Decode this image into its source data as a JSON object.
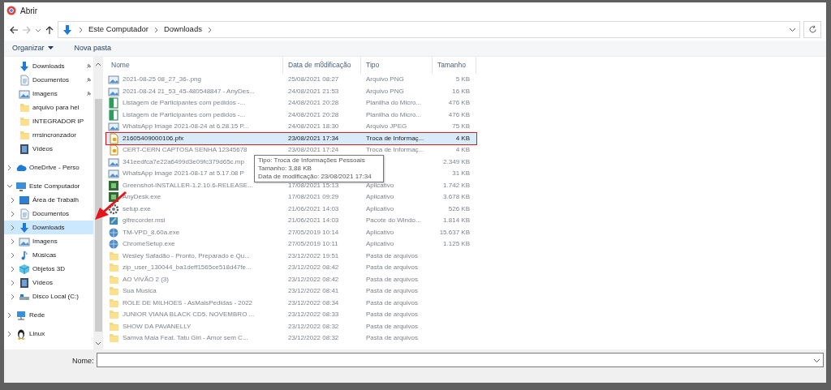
{
  "window": {
    "title": "Abrir"
  },
  "address": {
    "crumbs": [
      "Este Computador",
      "Downloads"
    ]
  },
  "toolbar": {
    "organize": "Organizar",
    "new_folder": "Nova pasta"
  },
  "sidebar": {
    "quick_access": [
      {
        "label": "Downloads",
        "kind": "download",
        "pinned": true
      },
      {
        "label": "Documentos",
        "kind": "document",
        "pinned": true
      },
      {
        "label": "Imagens",
        "kind": "image",
        "pinned": true
      },
      {
        "label": "arquivo para hel",
        "kind": "folder",
        "pinned": false
      },
      {
        "label": "INTEGRADOR IP",
        "kind": "folder",
        "pinned": false
      },
      {
        "label": "rrrsincronzador",
        "kind": "folder",
        "pinned": false
      },
      {
        "label": "Vídeos",
        "kind": "video",
        "pinned": false
      }
    ],
    "tree": [
      {
        "label": "OneDrive - Perso",
        "kind": "cloud",
        "expanded": false,
        "selected": false
      },
      {
        "label": "Este Computador",
        "kind": "computer",
        "expanded": true,
        "selected": false,
        "children": [
          {
            "label": "Área de Trabalh",
            "kind": "desktop",
            "expanded": false,
            "selected": false
          },
          {
            "label": "Documentos",
            "kind": "document",
            "expanded": false,
            "selected": false
          },
          {
            "label": "Downloads",
            "kind": "download",
            "expanded": false,
            "selected": true
          },
          {
            "label": "Imagens",
            "kind": "image",
            "expanded": false,
            "selected": false
          },
          {
            "label": "Músicas",
            "kind": "music",
            "expanded": false,
            "selected": false
          },
          {
            "label": "Objetos 3D",
            "kind": "cube",
            "expanded": false,
            "selected": false
          },
          {
            "label": "Vídeos",
            "kind": "video",
            "expanded": false,
            "selected": false
          },
          {
            "label": "Disco Local (C:)",
            "kind": "disk",
            "expanded": false,
            "selected": false
          }
        ]
      },
      {
        "label": "Rede",
        "kind": "network",
        "expanded": false,
        "selected": false
      },
      {
        "label": "Linux",
        "kind": "penguin",
        "expanded": false,
        "selected": false
      }
    ]
  },
  "table": {
    "columns": [
      "Nome",
      "Data de modificação",
      "Tipo",
      "Tamanho"
    ],
    "rows": [
      {
        "name": "2021-08-25 08_27_36-.png",
        "modified": "25/08/2021 08:27",
        "type": "Arquivo PNG",
        "size": "5 KB",
        "kind": "image",
        "selected": false,
        "obscured": true
      },
      {
        "name": "2021-08-24 21_53_45-480548847 - AnyDes...",
        "modified": "24/08/2021 21:53",
        "type": "Arquivo PNG",
        "size": "16 KB",
        "kind": "image",
        "selected": false,
        "obscured": true
      },
      {
        "name": "Listagem de Participantes com pedidos -...",
        "modified": "24/08/2021 20:28",
        "type": "Planilha do Micro...",
        "size": "476 KB",
        "kind": "sheet",
        "selected": false,
        "obscured": true
      },
      {
        "name": "Listagem de Participantes com pedidos -...",
        "modified": "24/08/2021 20:28",
        "type": "Planilha do Micro...",
        "size": "476 KB",
        "kind": "sheet",
        "selected": false,
        "obscured": true
      },
      {
        "name": "WhatsApp Image 2021-08-24 at 6.28.15 P...",
        "modified": "24/08/2021 18:30",
        "type": "Arquivo JPEG",
        "size": "75 KB",
        "kind": "image",
        "selected": false,
        "obscured": true
      },
      {
        "name": "21605409000106.pfx",
        "modified": "23/08/2021 17:34",
        "type": "Troca de Informaç...",
        "size": "4 KB",
        "kind": "cert",
        "selected": true,
        "obscured": false,
        "marked": true
      },
      {
        "name": "CERT-CERN CAPTOSA SENHA 12345678",
        "modified": "23/08/2021 17:24",
        "type": "Troca de Informaç...",
        "size": "4 KB",
        "kind": "cert",
        "selected": false,
        "obscured": true
      },
      {
        "name": "341eedfca7e22a6499d3e09fc379d65c.mp",
        "size": "2.349 KB",
        "kind": "image",
        "selected": false,
        "obscured": true
      },
      {
        "name": "WhatsApp Image 2021-08-17 at 5.17.08 P",
        "size": "31 KB",
        "kind": "image",
        "selected": false,
        "obscured": true
      },
      {
        "name": "Greenshot-INSTALLER-1.2.10.6-RELEASE...",
        "modified": "17/08/2021 15:13",
        "type": "Aplicativo",
        "size": "1.742 KB",
        "kind": "app",
        "selected": false,
        "obscured": true
      },
      {
        "name": "AnyDesk.exe",
        "modified": "17/08/2021 09:29",
        "type": "Aplicativo",
        "size": "3.678 KB",
        "kind": "app",
        "selected": false,
        "obscured": true
      },
      {
        "name": "setup.exe",
        "modified": "21/06/2021 14:03",
        "type": "Aplicativo",
        "size": "526 KB",
        "kind": "gear",
        "selected": false,
        "obscured": true
      },
      {
        "name": "gifrecorder.msi",
        "modified": "21/06/2021 14:03",
        "type": "Pacote do Windo...",
        "size": "1.814 KB",
        "kind": "installer",
        "selected": false,
        "obscured": true
      },
      {
        "name": "TM-VPD_8.60a.exe",
        "modified": "27/05/2019 10:14",
        "type": "Aplicativo",
        "size": "15.637 KB",
        "kind": "globe",
        "selected": false,
        "obscured": true
      },
      {
        "name": "ChromeSetup.exe",
        "modified": "27/05/2019 10:11",
        "type": "Aplicativo",
        "size": "1.125 KB",
        "kind": "globe",
        "selected": false,
        "obscured": true
      },
      {
        "name": "Wesley Safadão - Pronto, Preparado e Qu...",
        "modified": "23/12/2022 19:51",
        "type": "Pasta de arquivos",
        "kind": "folder",
        "selected": false,
        "obscured": true
      },
      {
        "name": "zip_user_130044_ba1deff1565ce518d47fe...",
        "modified": "23/12/2022 08:42",
        "type": "Pasta de arquivos",
        "kind": "folder",
        "selected": false,
        "obscured": true
      },
      {
        "name": "AO VIVÃO 2 (3)",
        "modified": "23/12/2022 08:42",
        "type": "Pasta de arquivos",
        "kind": "folder",
        "selected": false,
        "obscured": true
      },
      {
        "name": "Sua Musica",
        "modified": "23/12/2022 08:41",
        "type": "Pasta de arquivos",
        "kind": "folder",
        "selected": false,
        "obscured": true
      },
      {
        "name": "ROLE DE MILHOES - AsMaisPedidas - 2022",
        "modified": "23/12/2022 08:34",
        "type": "Pasta de arquivos",
        "kind": "folder",
        "selected": false,
        "obscured": true
      },
      {
        "name": "JUNIOR VIANA BLACK CD5. NOVEMBRO ...",
        "modified": "23/12/2022 08:33",
        "type": "Pasta de arquivos",
        "kind": "folder",
        "selected": false,
        "obscured": true
      },
      {
        "name": "SHOW DA PAVANELLY",
        "modified": "23/12/2022 08:32",
        "type": "Pasta de arquivos",
        "kind": "folder",
        "selected": false,
        "obscured": true
      },
      {
        "name": "Samva Maia Feat. Tatu Girl - Amor sem C...",
        "modified": "23/12/2022 08:32",
        "type": "Pasta de arquivos",
        "kind": "folder",
        "selected": false,
        "obscured": true
      }
    ]
  },
  "tooltip": {
    "lines": [
      "Tipo: Troca de Informações Pessoais",
      "Tamanho: 3,88 KB",
      "Data de modificação: 23/08/2021 17:34"
    ]
  },
  "filename": {
    "label": "Nome:"
  }
}
